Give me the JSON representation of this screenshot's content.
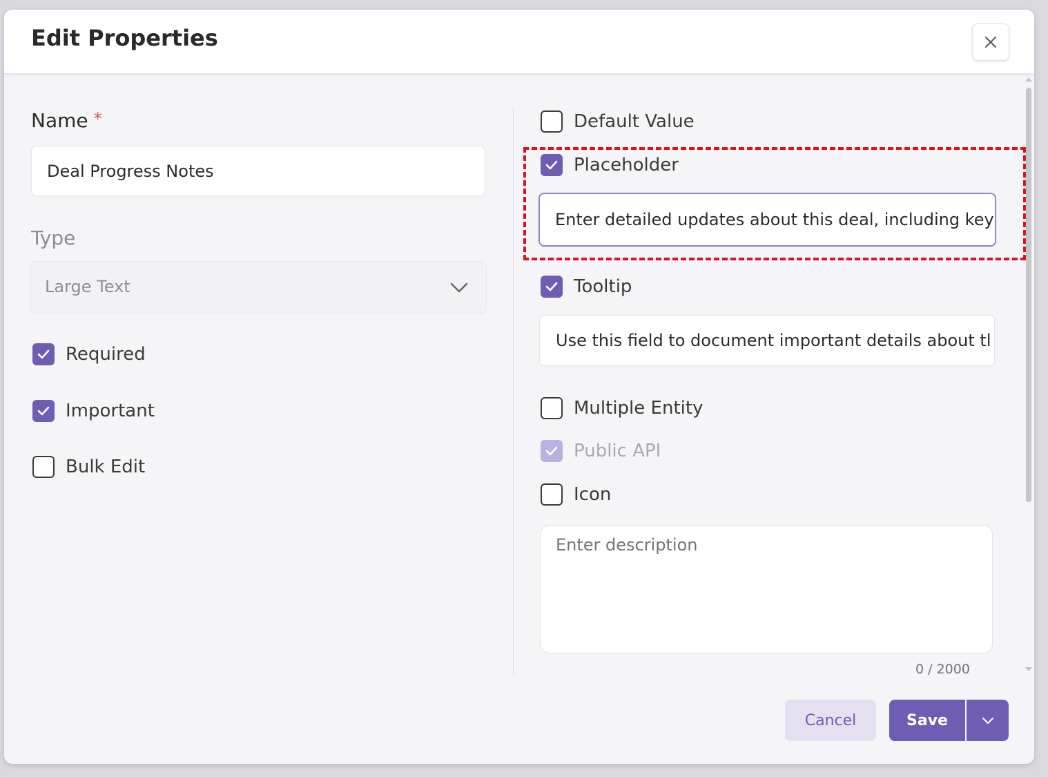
{
  "dialog": {
    "title": "Edit Properties"
  },
  "left": {
    "name_label": "Name",
    "name_required_mark": "*",
    "name_value": "Deal Progress Notes",
    "type_label": "Type",
    "type_value": "Large Text",
    "checkboxes": [
      {
        "label": "Required",
        "checked": true
      },
      {
        "label": "Important",
        "checked": true
      },
      {
        "label": "Bulk Edit",
        "checked": false
      }
    ]
  },
  "right": {
    "default_value": {
      "label": "Default Value",
      "checked": false
    },
    "placeholder": {
      "label": "Placeholder",
      "checked": true,
      "value": "Enter detailed updates about this deal, including key"
    },
    "tooltip": {
      "label": "Tooltip",
      "checked": true,
      "value": "Use this field to document important details about tl"
    },
    "multiple_entity": {
      "label": "Multiple Entity",
      "checked": false
    },
    "public_api": {
      "label": "Public API",
      "checked": true,
      "disabled": true
    },
    "icon": {
      "label": "Icon",
      "checked": false
    },
    "description": {
      "placeholder": "Enter description",
      "value": ""
    },
    "counter": "0 / 2000"
  },
  "footer": {
    "cancel_label": "Cancel",
    "save_label": "Save"
  },
  "colors": {
    "accent": "#6e5db3",
    "highlight": "#e0101c"
  }
}
